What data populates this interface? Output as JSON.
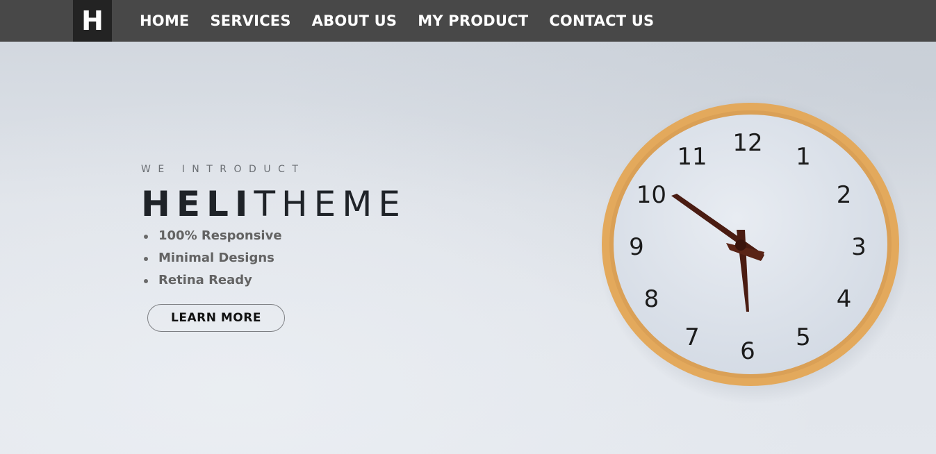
{
  "logo": {
    "letter": "H"
  },
  "nav": {
    "items": [
      "HOME",
      "SERVICES",
      "ABOUT US",
      "MY PRODUCT",
      "CONTACT US"
    ]
  },
  "hero": {
    "intro": "WE INTRODUCT",
    "title_bold": "HELI",
    "title_light": "THEME",
    "features": [
      "100% Responsive",
      "Minimal Designs",
      "Retina Ready"
    ],
    "button_label": "LEARN MORE"
  },
  "clock": {
    "numbers": [
      "12",
      "1",
      "2",
      "3",
      "4",
      "5",
      "6",
      "7",
      "8",
      "9",
      "10",
      "11"
    ],
    "colors": {
      "frame": "#e3a95c",
      "face": "#dfe4ec",
      "hands": "#4a1c12"
    }
  }
}
